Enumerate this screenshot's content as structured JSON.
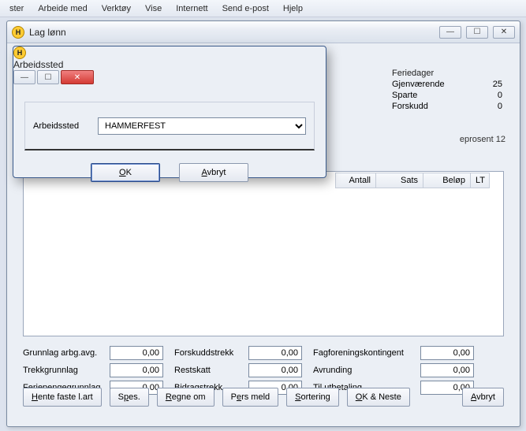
{
  "menu": {
    "items": [
      "ster",
      "Arbeide med",
      "Verktøy",
      "Vise",
      "Internett",
      "Send e-post",
      "Hjelp"
    ]
  },
  "main_window": {
    "title": "Lag lønn",
    "icon_letter": "H"
  },
  "feriedager": {
    "header": "Feriedager",
    "rows": [
      {
        "label": "Gjenværende",
        "value": "25"
      },
      {
        "label": "Sparte",
        "value": "0"
      },
      {
        "label": "Forskudd",
        "value": "0"
      }
    ]
  },
  "mid_text": "eprosent 12",
  "grid": {
    "headers": [
      "Antall",
      "Sats",
      "Beløp",
      "LT"
    ]
  },
  "fields": {
    "row1": {
      "l1": "Grunnlag arbg.avg.",
      "v1": "0,00",
      "l2": "Forskuddstrekk",
      "v2": "0,00",
      "l3": "Fagforeningskontingent",
      "v3": "0,00"
    },
    "row2": {
      "l1": "Trekkgrunnlag",
      "v1": "0,00",
      "l2": "Restskatt",
      "v2": "0,00",
      "l3": "Avrunding",
      "v3": "0,00"
    },
    "row3": {
      "l1": "Feriepengegrunnlag",
      "v1": "0,00",
      "l2": "Bidragstrekk",
      "v2": "0,00",
      "l3": "Til utbetaling",
      "v3": "0,00"
    }
  },
  "buttons": {
    "hente": "Hente faste l.art",
    "spes": "Spes.",
    "regne": "Regne om",
    "pers": "Pers meld",
    "sort": "Sortering",
    "okneste": "OK & Neste",
    "avbryt": "Avbryt"
  },
  "dialog": {
    "title": "Arbeidssted",
    "icon_letter": "H",
    "field_label": "Arbeidssted",
    "field_value": "HAMMERFEST",
    "ok": "OK",
    "cancel": "Avbryt",
    "close_glyph": "✕",
    "min_glyph": "—",
    "max_glyph": "☐"
  }
}
